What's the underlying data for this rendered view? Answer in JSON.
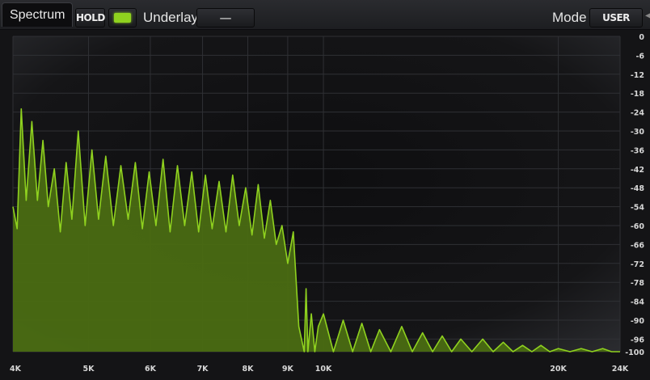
{
  "toolbar": {
    "tab_label": "Spectrum",
    "hold_label": "HOLD",
    "underlay_label": "Underlay",
    "underlay_value": "—",
    "mode_label": "Mode",
    "mode_value": "USER",
    "trace_color": "#8fd11f"
  },
  "chart_data": {
    "type": "area",
    "x_scale": "log",
    "x_ticks": [
      {
        "label": "4K",
        "value": 4000
      },
      {
        "label": "5K",
        "value": 5000
      },
      {
        "label": "6K",
        "value": 6000
      },
      {
        "label": "7K",
        "value": 7000
      },
      {
        "label": "8K",
        "value": 8000
      },
      {
        "label": "9K",
        "value": 9000
      },
      {
        "label": "10K",
        "value": 10000
      },
      {
        "label": "20K",
        "value": 20000
      },
      {
        "label": "24K",
        "value": 24000
      }
    ],
    "y_ticks": [
      0,
      -6,
      -12,
      -18,
      -24,
      -30,
      -36,
      -42,
      -48,
      -54,
      -60,
      -66,
      -72,
      -78,
      -84,
      -90,
      -96,
      -100
    ],
    "xlim": [
      4000,
      24000
    ],
    "ylim": [
      -100,
      0
    ],
    "grid": true,
    "line_color": "#8fd11f",
    "fill_color": "#4a6b12",
    "series": [
      {
        "x": [
          4000,
          4050,
          4100,
          4160,
          4230,
          4300,
          4370,
          4440,
          4520,
          4600,
          4680,
          4760,
          4850,
          4950,
          5050,
          5150,
          5260,
          5380,
          5500,
          5620,
          5740,
          5860,
          5980,
          6100,
          6230,
          6360,
          6500,
          6640,
          6780,
          6920,
          7060,
          7200,
          7350,
          7500,
          7650,
          7800,
          7950,
          8100,
          8250,
          8400,
          8550,
          8700,
          8850,
          9000,
          9150,
          9300,
          9450,
          9500,
          9550,
          9650,
          9750,
          9850,
          10000,
          10300,
          10600,
          10900,
          11200,
          11500,
          11800,
          12200,
          12600,
          13000,
          13400,
          13800,
          14200,
          14600,
          15000,
          15500,
          16000,
          16500,
          17000,
          17500,
          18000,
          18500,
          19000,
          19500,
          20000,
          20700,
          21400,
          22100,
          22800,
          23400,
          24000
        ],
        "y": [
          -54,
          -61,
          -23,
          -52,
          -27,
          -52,
          -33,
          -54,
          -42,
          -62,
          -40,
          -58,
          -30,
          -60,
          -36,
          -58,
          -38,
          -60,
          -41,
          -58,
          -40,
          -61,
          -43,
          -60,
          -39,
          -62,
          -41,
          -60,
          -43,
          -62,
          -44,
          -61,
          -46,
          -62,
          -44,
          -60,
          -48,
          -63,
          -47,
          -64,
          -52,
          -66,
          -60,
          -72,
          -62,
          -92,
          -100,
          -80,
          -100,
          -88,
          -100,
          -92,
          -88,
          -100,
          -90,
          -100,
          -91,
          -100,
          -93,
          -100,
          -92,
          -100,
          -94,
          -100,
          -95,
          -100,
          -96,
          -100,
          -96,
          -100,
          -97,
          -100,
          -98,
          -100,
          -98,
          -100,
          -99,
          -100,
          -99,
          -100,
          -99,
          -100,
          -100
        ]
      }
    ]
  }
}
